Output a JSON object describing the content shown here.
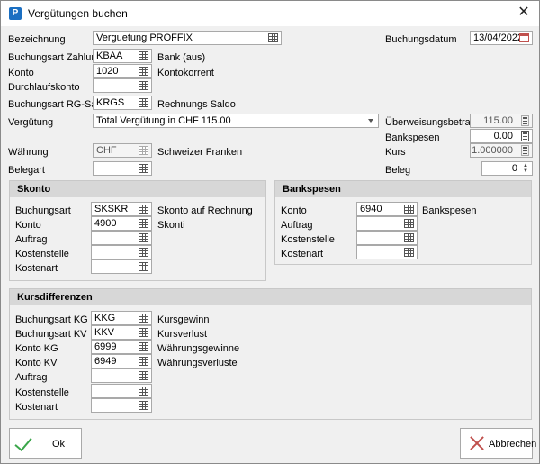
{
  "window": {
    "title": "Vergütungen buchen",
    "app_icon_letter": "P",
    "close_glyph": "✕"
  },
  "form": {
    "bezeichnung": {
      "label": "Bezeichnung",
      "value": "Verguetung PROFFIX"
    },
    "buchungsdatum": {
      "label": "Buchungsdatum",
      "value": "13/04/2022"
    },
    "buchungsart_zahlung": {
      "label": "Buchungsart Zahlung",
      "value": "KBAA",
      "desc": "Bank (aus)"
    },
    "konto": {
      "label": "Konto",
      "value": "1020",
      "desc": "Kontokorrent"
    },
    "durchlaufkonto": {
      "label": "Durchlaufskonto",
      "value": ""
    },
    "buchungsart_rg_saldo": {
      "label": "Buchungsart RG-Saldo",
      "value": "KRGS",
      "desc": "Rechnungs Saldo"
    },
    "verguetung": {
      "label": "Vergütung",
      "value": "Total Vergütung in CHF 115.00"
    },
    "ueberweisungsbetrag": {
      "label": "Überweisungsbetrag",
      "value": "115.00"
    },
    "bankspesen": {
      "label": "Bankspesen",
      "value": "0.00"
    },
    "waehrung": {
      "label": "Währung",
      "value": "CHF",
      "desc": "Schweizer Franken"
    },
    "kurs": {
      "label": "Kurs",
      "value": "1.000000"
    },
    "belegart": {
      "label": "Belegart",
      "value": ""
    },
    "beleg": {
      "label": "Beleg",
      "value": "0"
    }
  },
  "skonto": {
    "title": "Skonto",
    "buchungsart": {
      "label": "Buchungsart",
      "value": "SKSKR",
      "desc": "Skonto auf Rechnung"
    },
    "konto": {
      "label": "Konto",
      "value": "4900",
      "desc": "Skonti"
    },
    "auftrag": {
      "label": "Auftrag",
      "value": ""
    },
    "kostenstelle": {
      "label": "Kostenstelle",
      "value": ""
    },
    "kostenart": {
      "label": "Kostenart",
      "value": ""
    }
  },
  "bankspesen_group": {
    "title": "Bankspesen",
    "konto": {
      "label": "Konto",
      "value": "6940",
      "desc": "Bankspesen"
    },
    "auftrag": {
      "label": "Auftrag",
      "value": ""
    },
    "kostenstelle": {
      "label": "Kostenstelle",
      "value": ""
    },
    "kostenart": {
      "label": "Kostenart",
      "value": ""
    }
  },
  "kursdifferenzen": {
    "title": "Kursdifferenzen",
    "buchungsart_kg": {
      "label": "Buchungsart KG",
      "value": "KKG",
      "desc": "Kursgewinn"
    },
    "buchungsart_kv": {
      "label": "Buchungsart KV",
      "value": "KKV",
      "desc": "Kursverlust"
    },
    "konto_kg": {
      "label": "Konto KG",
      "value": "6999",
      "desc": "Währungsgewinne"
    },
    "konto_kv": {
      "label": "Konto KV",
      "value": "6949",
      "desc": "Währungsverluste"
    },
    "auftrag": {
      "label": "Auftrag",
      "value": ""
    },
    "kostenstelle": {
      "label": "Kostenstelle",
      "value": ""
    },
    "kostenart": {
      "label": "Kostenart",
      "value": ""
    }
  },
  "buttons": {
    "ok": "Ok",
    "cancel": "Abbrechen"
  }
}
